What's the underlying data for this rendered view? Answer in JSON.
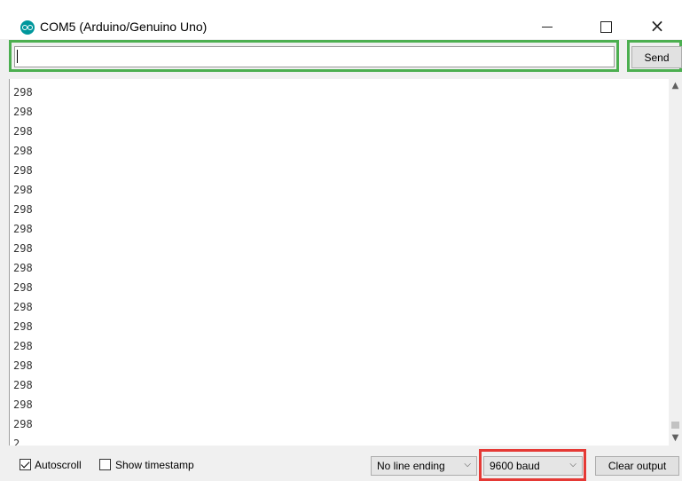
{
  "window": {
    "title": "COM5 (Arduino/Genuino Uno)",
    "icon": "arduino-logo-icon",
    "controls": {
      "minimize": "minimize-icon",
      "maximize": "maximize-icon",
      "close": "×"
    }
  },
  "send_row": {
    "input_value": "",
    "send_label": "Send",
    "highlight_color": "#4caf50"
  },
  "output": {
    "lines": [
      "298",
      "298",
      "298",
      "298",
      "298",
      "298",
      "298",
      "298",
      "298",
      "298",
      "298",
      "298",
      "298",
      "298",
      "298",
      "298",
      "298",
      "298",
      "2"
    ],
    "scroll_up": "^",
    "scroll_down": "v"
  },
  "bottom_bar": {
    "autoscroll_label": "Autoscroll",
    "autoscroll_checked": true,
    "timestamp_label": "Show timestamp",
    "timestamp_checked": false,
    "line_ending_value": "No line ending",
    "baud_value": "9600 baud",
    "baud_highlight_color": "#e53935",
    "clear_label": "Clear output"
  }
}
